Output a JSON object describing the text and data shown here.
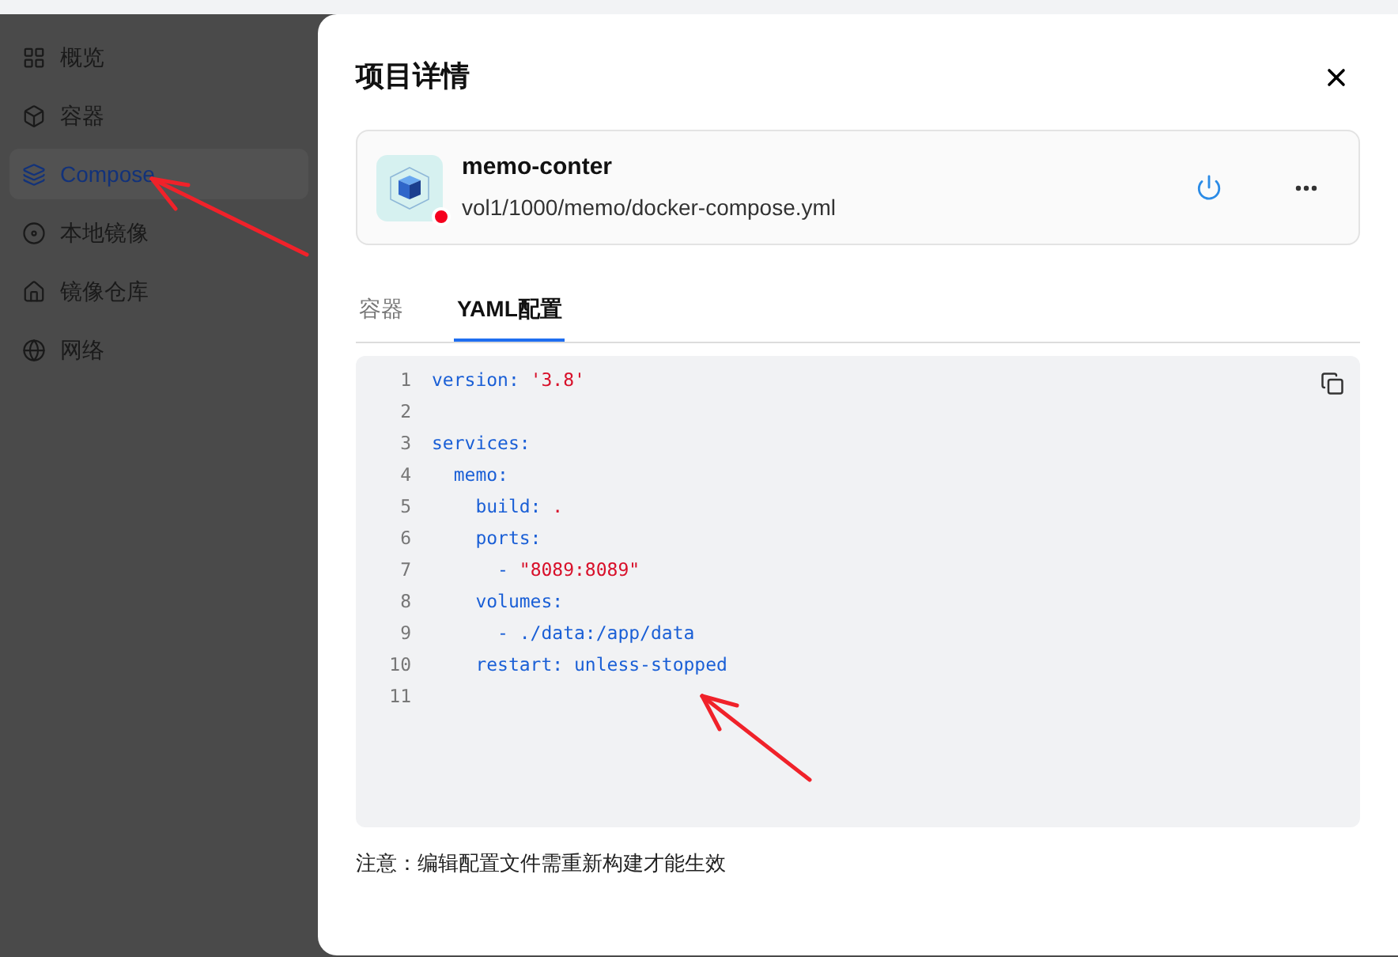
{
  "sidebar": {
    "items": [
      {
        "label": "概览",
        "selected": false
      },
      {
        "label": "容器",
        "selected": false
      },
      {
        "label": "Compose",
        "selected": true
      },
      {
        "label": "本地镜像",
        "selected": false
      },
      {
        "label": "镜像仓库",
        "selected": false
      },
      {
        "label": "网络",
        "selected": false
      }
    ]
  },
  "dialog": {
    "title": "项目详情",
    "project": {
      "name": "memo-conter",
      "path": "vol1/1000/memo/docker-compose.yml",
      "running": false
    },
    "tabs": [
      {
        "label": "容器",
        "selected": false
      },
      {
        "label": "YAML配置",
        "selected": true
      }
    ],
    "code_lines": [
      {
        "number": "1",
        "tokens": [
          {
            "text": "version: ",
            "kind": "key"
          },
          {
            "text": "'3.8'",
            "kind": "string"
          }
        ]
      },
      {
        "number": "2"
      },
      {
        "number": "3",
        "tokens": [
          {
            "text": "services:",
            "kind": "key"
          }
        ]
      },
      {
        "number": "4",
        "tokens": [
          {
            "text": "  memo:",
            "kind": "key"
          }
        ]
      },
      {
        "number": "5",
        "tokens": [
          {
            "text": "    build: ",
            "kind": "key"
          },
          {
            "text": ".",
            "kind": "string"
          }
        ]
      },
      {
        "number": "6",
        "tokens": [
          {
            "text": "    ports:",
            "kind": "key"
          }
        ]
      },
      {
        "number": "7",
        "tokens": [
          {
            "text": "      - ",
            "kind": "key"
          },
          {
            "text": "\"8089:8089\"",
            "kind": "string"
          }
        ]
      },
      {
        "number": "8",
        "tokens": [
          {
            "text": "    volumes:",
            "kind": "key"
          }
        ]
      },
      {
        "number": "9",
        "tokens": [
          {
            "text": "      - ./data:/app/data",
            "kind": "key"
          }
        ]
      },
      {
        "number": "10",
        "tokens": [
          {
            "text": "    restart: unless-stopped",
            "kind": "key"
          }
        ]
      },
      {
        "number": "11"
      }
    ],
    "note": "注意：编辑配置文件需重新构建才能生效"
  }
}
